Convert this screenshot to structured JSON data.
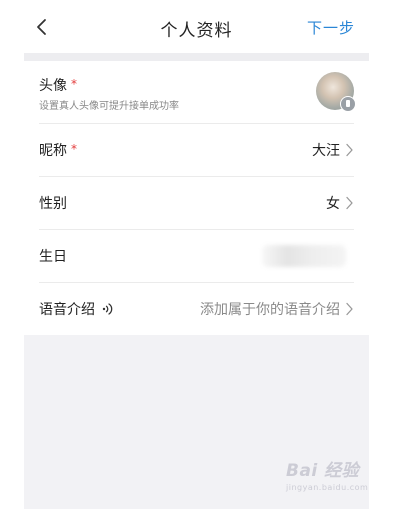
{
  "header": {
    "title": "个人资料",
    "next_label": "下一步"
  },
  "rows": {
    "avatar": {
      "label": "头像",
      "required_mark": "*",
      "hint": "设置真人头像可提升接单成功率"
    },
    "nickname": {
      "label": "昵称",
      "required_mark": "*",
      "value": "大汪"
    },
    "gender": {
      "label": "性别",
      "value": "女"
    },
    "birthday": {
      "label": "生日"
    },
    "voice_intro": {
      "label": "语音介绍",
      "value": "添加属于你的语音介绍"
    }
  },
  "watermark": {
    "main": "Bai 经验",
    "sub": "jingyan.baidu.com"
  },
  "colors": {
    "accent": "#2a86d6",
    "required": "#e33c3c",
    "background": "#f2f2f5"
  },
  "icons": [
    "chevron-left-icon",
    "chevron-right-icon",
    "voice-wave-icon",
    "camera-badge-icon"
  ]
}
